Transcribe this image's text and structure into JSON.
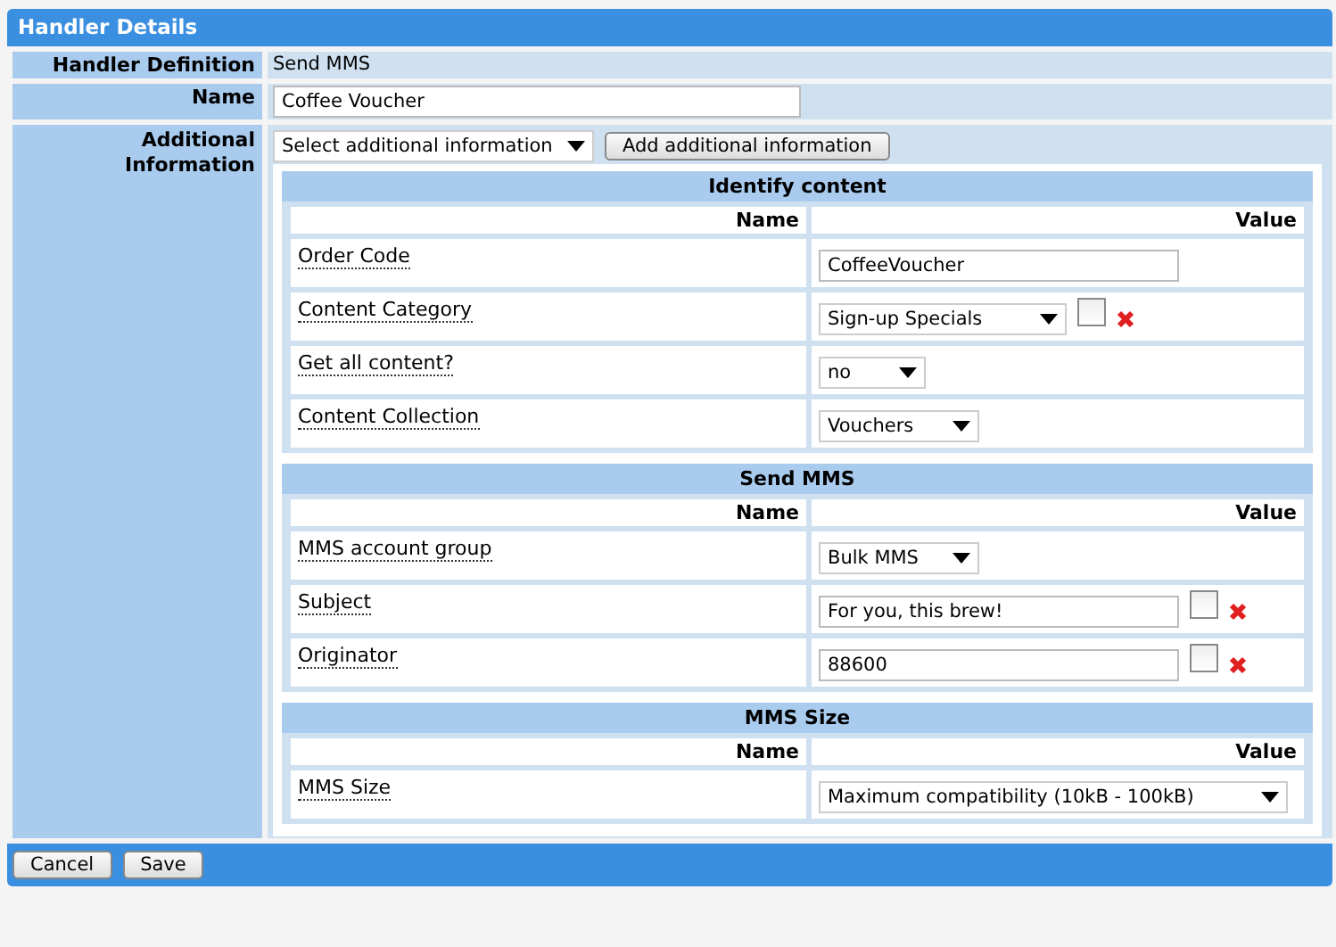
{
  "window": {
    "title": "Handler Details"
  },
  "handler_definition": {
    "label": "Handler Definition",
    "value": "Send MMS"
  },
  "name": {
    "label": "Name",
    "value": "Coffee Voucher"
  },
  "additional": {
    "label": "Additional Information",
    "select": "Select additional information",
    "button": "Add additional information"
  },
  "sections": [
    {
      "title": "Identify content",
      "name_header": "Name",
      "value_header": "Value",
      "rows": [
        {
          "name": "Order Code",
          "kind": "input",
          "value": "CoffeeVoucher",
          "removable": false
        },
        {
          "name": "Content Category",
          "kind": "select",
          "value": "Sign-up Specials",
          "removable": true,
          "checked": false
        },
        {
          "name": "Get all content?",
          "kind": "select",
          "value": "no",
          "removable": false
        },
        {
          "name": "Content Collection",
          "kind": "select",
          "value": "Vouchers",
          "removable": false
        }
      ]
    },
    {
      "title": "Send MMS",
      "name_header": "Name",
      "value_header": "Value",
      "rows": [
        {
          "name": "MMS account group",
          "kind": "select",
          "value": "Bulk MMS",
          "removable": false
        },
        {
          "name": "Subject",
          "kind": "input",
          "value": "For you, this brew!",
          "removable": true,
          "checked": false
        },
        {
          "name": "Originator",
          "kind": "input",
          "value": "88600",
          "removable": true,
          "checked": false
        }
      ]
    },
    {
      "title": "MMS Size",
      "name_header": "Name",
      "value_header": "Value",
      "rows": [
        {
          "name": "MMS Size",
          "kind": "select",
          "value": "Maximum compatibility (10kB - 100kB)",
          "removable": false
        }
      ]
    }
  ],
  "buttons": [
    "Cancel",
    "Save"
  ]
}
